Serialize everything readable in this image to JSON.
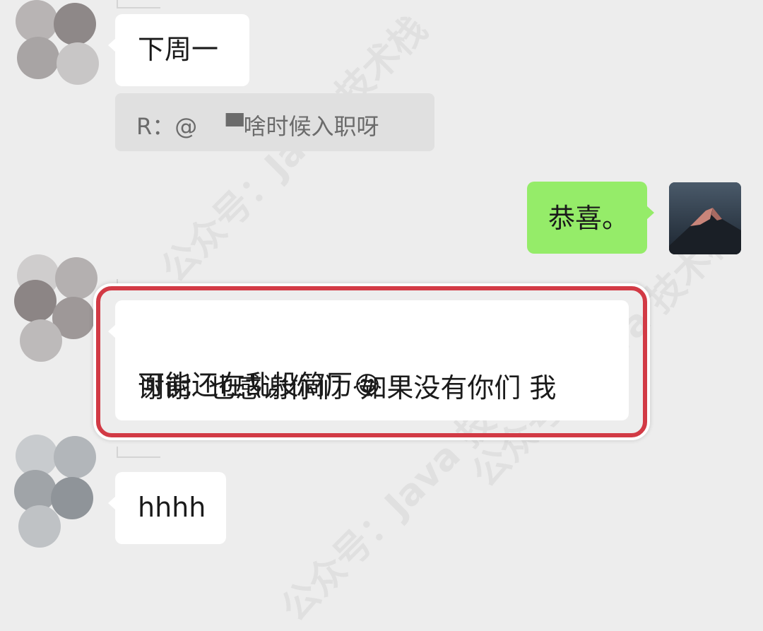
{
  "chat": {
    "messages": [
      {
        "side": "left",
        "text": "下周一"
      },
      {
        "type": "quote",
        "text": "R：@    ▀啥时候入职呀"
      },
      {
        "side": "right",
        "text": "恭喜。"
      },
      {
        "side": "left",
        "line1": "谢谢  也感谢你们  如果没有你们 我",
        "line2": "可能还在乱投简历",
        "emoji": "😂"
      },
      {
        "side": "left",
        "text": "hhhh"
      }
    ]
  },
  "watermark": {
    "text": "公众号：Java 技术栈"
  },
  "colors": {
    "background": "#ededed",
    "sent_bubble": "#95ec69",
    "received_bubble": "#ffffff",
    "highlight": "#d23a45"
  },
  "icons": {
    "avatar": "mountain-avatar-icon",
    "laugh": "tears-of-joy-emoji-icon"
  }
}
